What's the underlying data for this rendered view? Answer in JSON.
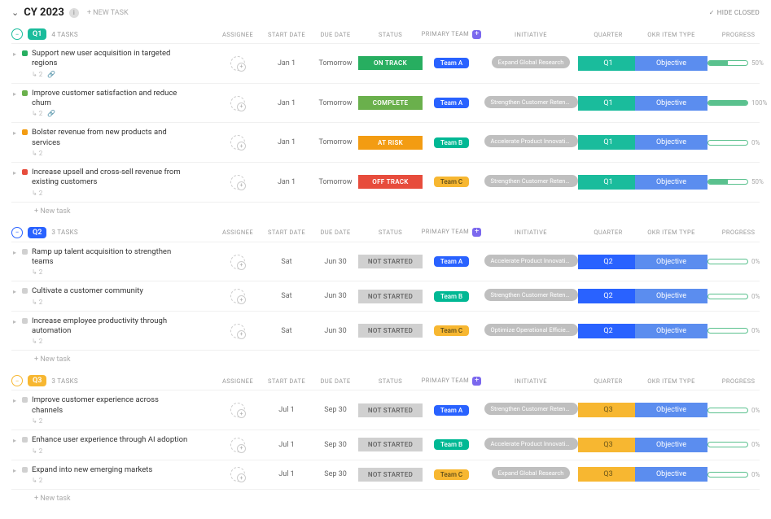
{
  "header": {
    "title": "CY 2023",
    "new_task": "+ NEW TASK",
    "hide_closed": "HIDE CLOSED"
  },
  "statuses": {
    "ontrack": "ON TRACK",
    "complete": "COMPLETE",
    "atrisk": "AT RISK",
    "offtrack": "OFF TRACK",
    "notstarted": "NOT STARTED"
  },
  "columns": {
    "assignee": "ASSIGNEE",
    "start": "START DATE",
    "due": "DUE DATE",
    "status": "STATUS",
    "team": "PRIMARY TEAM",
    "initiative": "INITIATIVE",
    "quarter": "QUARTER",
    "type": "OKR ITEM TYPE",
    "progress": "PROGRESS"
  },
  "labels": {
    "new_task_row": "+ New task",
    "objective": "Objective",
    "tasks_suffix": "TASKS"
  },
  "sections": [
    {
      "id": "q1",
      "label": "Q1",
      "color": "#1abc9c",
      "count": 4,
      "tasks": [
        {
          "dot": "#27ae60",
          "name": "Support new user acquisition in targeted regions",
          "subs": 2,
          "link": true,
          "start": "Jan 1",
          "due": "Tomorrow",
          "status": "ontrack",
          "team": "Team A",
          "team_cls": "team-a",
          "initiative": "Expand Global Research",
          "quarter": "Q1",
          "q_cls": "q-q1",
          "progress": 50
        },
        {
          "dot": "#6ab04c",
          "name": "Improve customer satisfaction and reduce churn",
          "subs": 2,
          "link": true,
          "start": "Jan 1",
          "due": "Tomorrow",
          "status": "complete",
          "team": "Team A",
          "team_cls": "team-a",
          "initiative": "Strengthen Customer Retenti...",
          "quarter": "Q1",
          "q_cls": "q-q1",
          "progress": 100
        },
        {
          "dot": "#f39c12",
          "name": "Bolster revenue from new products and services",
          "subs": 2,
          "link": false,
          "start": "Jan 1",
          "due": "Tomorrow",
          "status": "atrisk",
          "team": "Team B",
          "team_cls": "team-b",
          "initiative": "Accelerate Product Innovation",
          "quarter": "Q1",
          "q_cls": "q-q1",
          "progress": 0
        },
        {
          "dot": "#e74c3c",
          "name": "Increase upsell and cross-sell revenue from existing customers",
          "subs": 2,
          "link": false,
          "start": "Jan 1",
          "due": "Tomorrow",
          "status": "offtrack",
          "team": "Team C",
          "team_cls": "team-c",
          "initiative": "Strengthen Customer Retenti...",
          "quarter": "Q1",
          "q_cls": "q-q1",
          "progress": 50
        }
      ]
    },
    {
      "id": "q2",
      "label": "Q2",
      "color": "#2962ff",
      "count": 3,
      "tasks": [
        {
          "dot": "#d0d0d0",
          "name": "Ramp up talent acquisition to strengthen teams",
          "subs": 2,
          "link": false,
          "start": "Sat",
          "due": "Jun 30",
          "status": "notstarted",
          "team": "Team A",
          "team_cls": "team-a",
          "initiative": "Accelerate Product Innovation",
          "quarter": "Q2",
          "q_cls": "q-q2",
          "progress": 0
        },
        {
          "dot": "#d0d0d0",
          "name": "Cultivate a customer community",
          "subs": 2,
          "link": false,
          "start": "Sat",
          "due": "Jun 30",
          "status": "notstarted",
          "team": "Team B",
          "team_cls": "team-b",
          "initiative": "Strengthen Customer Retenti...",
          "quarter": "Q2",
          "q_cls": "q-q2",
          "progress": 0
        },
        {
          "dot": "#d0d0d0",
          "name": "Increase employee productivity through automation",
          "subs": 2,
          "link": false,
          "start": "Sat",
          "due": "Jun 30",
          "status": "notstarted",
          "team": "Team C",
          "team_cls": "team-c",
          "initiative": "Optimize Operational Efficien...",
          "quarter": "Q2",
          "q_cls": "q-q2",
          "progress": 0
        }
      ]
    },
    {
      "id": "q3",
      "label": "Q3",
      "color": "#f7b731",
      "count": 3,
      "tasks": [
        {
          "dot": "#d0d0d0",
          "name": "Improve customer experience across channels",
          "subs": 2,
          "link": false,
          "start": "Jul 1",
          "due": "Sep 30",
          "status": "notstarted",
          "team": "Team A",
          "team_cls": "team-a",
          "initiative": "Strengthen Customer Retenti...",
          "quarter": "Q3",
          "q_cls": "q-q3",
          "progress": 0
        },
        {
          "dot": "#d0d0d0",
          "name": "Enhance user experience through AI adoption",
          "subs": 2,
          "link": false,
          "start": "Jul 1",
          "due": "Sep 30",
          "status": "notstarted",
          "team": "Team B",
          "team_cls": "team-b",
          "initiative": "Accelerate Product Innovation",
          "quarter": "Q3",
          "q_cls": "q-q3",
          "progress": 0
        },
        {
          "dot": "#d0d0d0",
          "name": "Expand into new emerging markets",
          "subs": 2,
          "link": false,
          "start": "Jul 1",
          "due": "Sep 30",
          "status": "notstarted",
          "team": "Team C",
          "team_cls": "team-c",
          "initiative": "Expand Global Research",
          "quarter": "Q3",
          "q_cls": "q-q3",
          "progress": 0
        }
      ]
    }
  ]
}
